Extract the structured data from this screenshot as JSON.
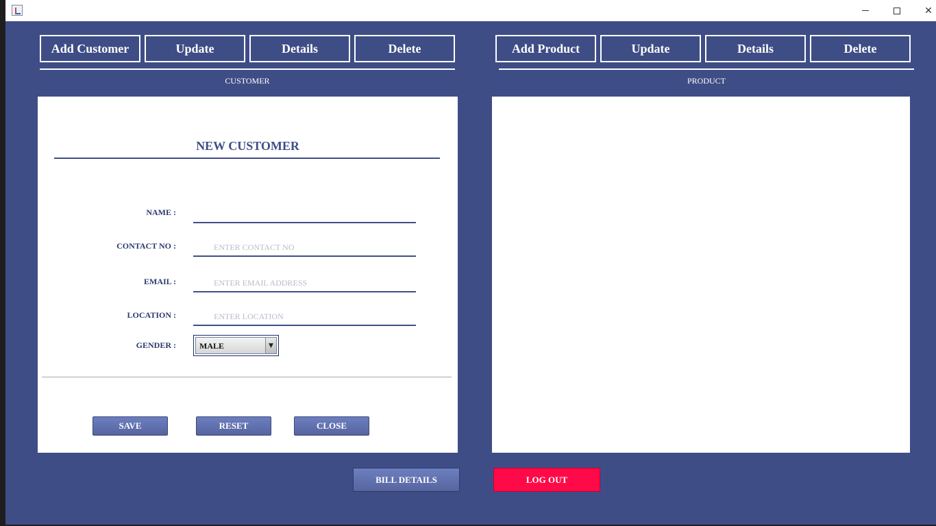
{
  "window": {
    "icon": "java-app-icon",
    "minimize_label": "minimize",
    "maximize_label": "maximize",
    "close_glyph": "✕"
  },
  "customer_tabs": {
    "add": "Add Customer",
    "update": "Update",
    "details": "Details",
    "delete": "Delete"
  },
  "product_tabs": {
    "add": "Add Product",
    "update": "Update",
    "details": "Details",
    "delete": "Delete"
  },
  "customer_section_label": "CUSTOMER",
  "product_section_label": "PRODUCT",
  "form": {
    "title": "NEW CUSTOMER",
    "name_label": "NAME :",
    "name_value": "",
    "contact_label": "CONTACT NO :",
    "contact_placeholder": "ENTER CONTACT NO",
    "email_label": "EMAIL :",
    "email_placeholder": "ENTER EMAIL ADDRESS",
    "location_label": "LOCATION :",
    "location_placeholder": "ENTER LOCATION",
    "gender_label": "GENDER :",
    "gender_value": "MALE",
    "gender_arrow": "▼",
    "save": "SAVE",
    "reset": "RESET",
    "close": "CLOSE"
  },
  "footer": {
    "bill_details": "BILL DETAILS",
    "logout": "LOG OUT"
  },
  "colors": {
    "background": "#3f4d86",
    "accent": "#3f4d86",
    "logout": "#ff0a48"
  }
}
